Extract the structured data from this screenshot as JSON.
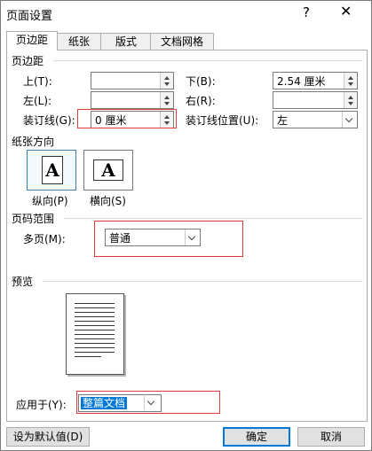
{
  "window": {
    "title": "页面设置",
    "help": "?",
    "close": "✕"
  },
  "tabs": [
    "页边距",
    "纸张",
    "版式",
    "文档网格"
  ],
  "margins": {
    "section": "页边距",
    "top_label": "上(T):",
    "top_value": "",
    "bottom_label": "下(B):",
    "bottom_value": "2.54 厘米",
    "left_label": "左(L):",
    "left_value": "",
    "right_label": "右(R):",
    "right_value": "",
    "gutter_label": "装订线(G):",
    "gutter_value": "0 厘米",
    "gutter_pos_label": "装订线位置(U):",
    "gutter_pos_value": "左"
  },
  "orientation": {
    "section": "纸张方向",
    "portrait_label": "纵向(P)",
    "landscape_label": "横向(S)",
    "glyph": "A"
  },
  "pages": {
    "section": "页码范围",
    "multi_label": "多页(M):",
    "multi_value": "普通"
  },
  "preview": {
    "section": "预览"
  },
  "apply": {
    "label": "应用于(Y):",
    "value": "整篇文档"
  },
  "buttons": {
    "default": "设为默认值(D)",
    "ok": "确定",
    "cancel": "取消"
  },
  "colors": {
    "accent": "#0078d7",
    "highlight_box": "#e53a3a"
  }
}
